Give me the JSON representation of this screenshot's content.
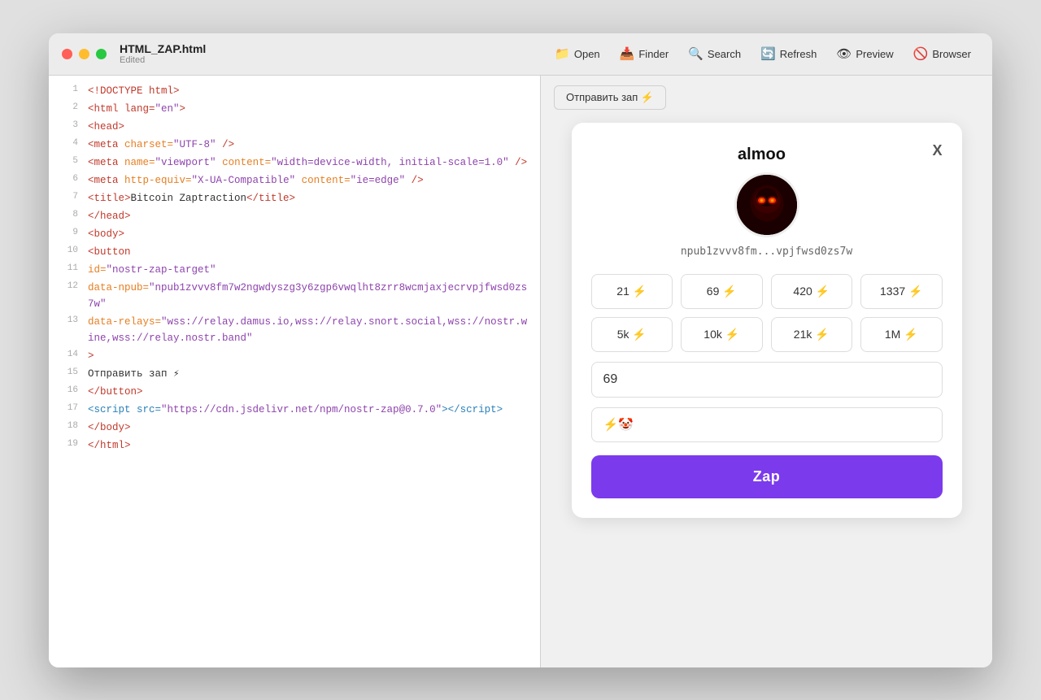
{
  "window": {
    "title": "HTML_ZAP.html",
    "subtitle": "Edited"
  },
  "toolbar": {
    "open_label": "Open",
    "finder_label": "Finder",
    "search_label": "Search",
    "refresh_label": "Refresh",
    "preview_label": "Preview",
    "browser_label": "Browser"
  },
  "code": {
    "lines": [
      {
        "num": 1,
        "html": "<span class='tag'>&lt;!DOCTYPE html&gt;</span>"
      },
      {
        "num": 2,
        "html": "<span class='tag'>&lt;html lang=</span><span class='val'>\"en\"</span><span class='tag'>&gt;</span>"
      },
      {
        "num": 3,
        "html": "<span class='tag'>&lt;head&gt;</span>"
      },
      {
        "num": 4,
        "html": "<span class='tag'>&lt;meta</span> <span class='attr'>charset=</span><span class='val'>\"UTF-8\"</span> <span class='tag'>/&gt;</span>"
      },
      {
        "num": 5,
        "html": "<span class='tag'>&lt;meta</span> <span class='attr'>name=</span><span class='val'>\"viewport\"</span> <span class='attr'>content=</span><span class='val'>\"width=device-width, initial-scale=1.0\"</span> <span class='tag'>/&gt;</span>"
      },
      {
        "num": 6,
        "html": "<span class='tag'>&lt;meta</span> <span class='attr'>http-equiv=</span><span class='val'>\"X-UA-Compatible\"</span> <span class='attr'>content=</span><span class='val'>\"ie=edge\"</span> <span class='tag'>/&gt;</span>"
      },
      {
        "num": 7,
        "html": "<span class='tag'>&lt;title&gt;</span><span class='text-content'>Bitcoin Zaptraction</span><span class='tag'>&lt;/title&gt;</span>"
      },
      {
        "num": 8,
        "html": "<span class='tag'>&lt;/head&gt;</span>"
      },
      {
        "num": 9,
        "html": "<span class='tag'>&lt;body&gt;</span>"
      },
      {
        "num": 10,
        "html": "<span class='tag'>&lt;button</span>"
      },
      {
        "num": 11,
        "html": "<span class='attr'>id=</span><span class='val'>\"nostr-zap-target\"</span>"
      },
      {
        "num": 12,
        "html": "<span class='attr'>data-npub=</span><span class='val'>\"npub1zvvv8fm7w2ngwdyszg3y6zgp6vwqlht8zrr8wcmjaxjecrvpjfwsd0zs7w\"</span>"
      },
      {
        "num": 13,
        "html": "<span class='attr'>data-relays=</span><span class='val'>\"wss://relay.damus.io,wss://relay.snort.social,wss://nostr.wine,wss://relay.nostr.band\"</span>"
      },
      {
        "num": 14,
        "html": "<span class='tag'>&gt;</span>"
      },
      {
        "num": 15,
        "html": "<span class='russian-text'>Отправить зап ⚡</span>"
      },
      {
        "num": 16,
        "html": "<span class='tag'>&lt;/button&gt;</span>"
      },
      {
        "num": 17,
        "html": "<span class='script-tag'>&lt;script src=</span><span class='val'>\"https://cdn.jsdelivr.net/npm/nostr-zap@0.7.0\"</span><span class='script-tag'>&gt;&lt;/script&gt;</span>"
      },
      {
        "num": 18,
        "html": "<span class='tag'>&lt;/body&gt;</span>"
      },
      {
        "num": 19,
        "html": "<span class='tag'>&lt;/html&gt;</span>"
      }
    ]
  },
  "preview": {
    "send_zap_button": "Отправить зап ⚡",
    "modal": {
      "close_label": "X",
      "profile_name": "almoo",
      "pubkey": "npub1zvvv8fm...vpjfwsd0zs7w",
      "avatar_emoji": "😈",
      "amounts": [
        {
          "label": "21 ⚡",
          "value": 21
        },
        {
          "label": "69 ⚡",
          "value": 69
        },
        {
          "label": "420 ⚡",
          "value": 420
        },
        {
          "label": "1337 ⚡",
          "value": 1337
        },
        {
          "label": "5k ⚡",
          "value": 5000
        },
        {
          "label": "10k ⚡",
          "value": 10000
        },
        {
          "label": "21k ⚡",
          "value": 21000
        },
        {
          "label": "1M ⚡",
          "value": 1000000
        }
      ],
      "amount_input_value": "69",
      "comment_placeholder": "⚡🤡",
      "zap_button_label": "Zap"
    }
  }
}
